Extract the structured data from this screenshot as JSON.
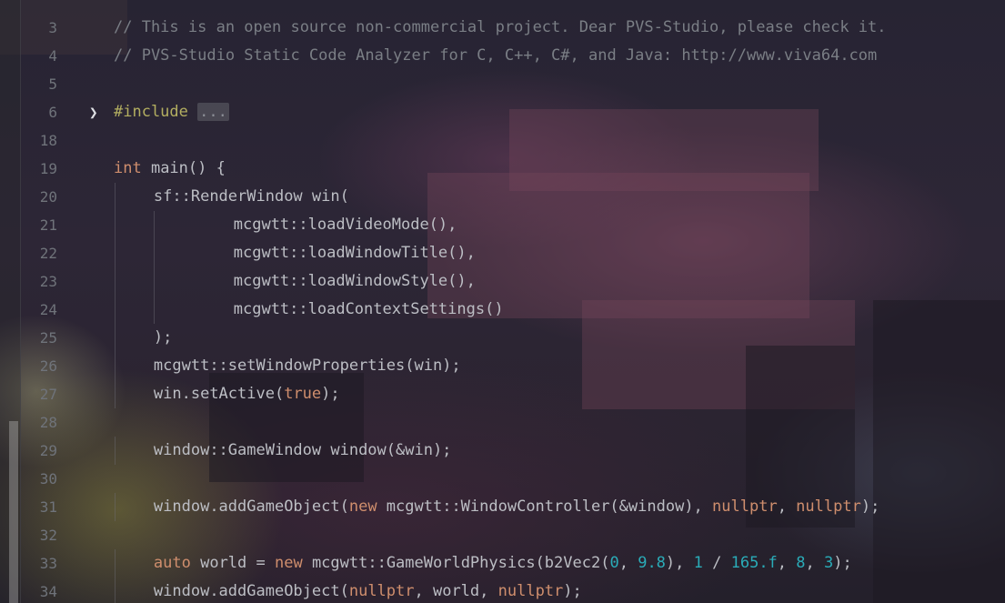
{
  "editor": {
    "lines": [
      {
        "n": "3",
        "indent": 0,
        "tokens": [
          {
            "t": "// This is an open source non-commercial project. Dear PVS-Studio, please check it.",
            "c": "comment"
          }
        ]
      },
      {
        "n": "4",
        "indent": 0,
        "tokens": [
          {
            "t": "// PVS-Studio Static Code Analyzer for C, C++, C#, and Java: http://www.viva64.com",
            "c": "comment"
          }
        ]
      },
      {
        "n": "5",
        "indent": 0,
        "tokens": []
      },
      {
        "n": "6",
        "indent": 0,
        "fold": true,
        "tokens": [
          {
            "t": "#include",
            "c": "pp"
          },
          {
            "t": " ",
            "c": "plain"
          },
          {
            "t": "...",
            "c": "fold"
          }
        ]
      },
      {
        "n": "18",
        "indent": 0,
        "tokens": []
      },
      {
        "n": "19",
        "indent": 0,
        "tokens": [
          {
            "t": "int",
            "c": "kw"
          },
          {
            "t": " main() {",
            "c": "plain"
          }
        ]
      },
      {
        "n": "20",
        "indent": 4,
        "tokens": [
          {
            "t": "sf::RenderWindow win(",
            "c": "plain"
          }
        ]
      },
      {
        "n": "21",
        "indent": 12,
        "tokens": [
          {
            "t": "mcgwtt::loadVideoMode(),",
            "c": "plain"
          }
        ]
      },
      {
        "n": "22",
        "indent": 12,
        "tokens": [
          {
            "t": "mcgwtt::loadWindowTitle(),",
            "c": "plain"
          }
        ]
      },
      {
        "n": "23",
        "indent": 12,
        "tokens": [
          {
            "t": "mcgwtt::loadWindowStyle(),",
            "c": "plain"
          }
        ]
      },
      {
        "n": "24",
        "indent": 12,
        "tokens": [
          {
            "t": "mcgwtt::loadContextSettings()",
            "c": "plain"
          }
        ]
      },
      {
        "n": "25",
        "indent": 4,
        "tokens": [
          {
            "t": ");",
            "c": "plain"
          }
        ]
      },
      {
        "n": "26",
        "indent": 4,
        "tokens": [
          {
            "t": "mcgwtt::setWindowProperties(win);",
            "c": "plain"
          }
        ]
      },
      {
        "n": "27",
        "indent": 4,
        "tokens": [
          {
            "t": "win.setActive(",
            "c": "plain"
          },
          {
            "t": "true",
            "c": "kw"
          },
          {
            "t": ");",
            "c": "plain"
          }
        ]
      },
      {
        "n": "28",
        "indent": 0,
        "tokens": []
      },
      {
        "n": "29",
        "indent": 4,
        "tokens": [
          {
            "t": "window::GameWindow window(&win);",
            "c": "plain"
          }
        ]
      },
      {
        "n": "30",
        "indent": 0,
        "tokens": []
      },
      {
        "n": "31",
        "indent": 4,
        "tokens": [
          {
            "t": "window.addGameObject(",
            "c": "plain"
          },
          {
            "t": "new",
            "c": "kw"
          },
          {
            "t": " mcgwtt::WindowController(&window), ",
            "c": "plain"
          },
          {
            "t": "nullptr",
            "c": "kw"
          },
          {
            "t": ", ",
            "c": "plain"
          },
          {
            "t": "nullptr",
            "c": "kw"
          },
          {
            "t": ");",
            "c": "plain"
          }
        ]
      },
      {
        "n": "32",
        "indent": 0,
        "tokens": []
      },
      {
        "n": "33",
        "indent": 4,
        "tokens": [
          {
            "t": "auto",
            "c": "kw"
          },
          {
            "t": " world = ",
            "c": "plain"
          },
          {
            "t": "new",
            "c": "kw"
          },
          {
            "t": " mcgwtt::GameWorldPhysics(b2Vec2(",
            "c": "plain"
          },
          {
            "t": "0",
            "c": "num"
          },
          {
            "t": ", ",
            "c": "plain"
          },
          {
            "t": "9.8",
            "c": "num"
          },
          {
            "t": "), ",
            "c": "plain"
          },
          {
            "t": "1",
            "c": "num"
          },
          {
            "t": " / ",
            "c": "plain"
          },
          {
            "t": "165.f",
            "c": "num"
          },
          {
            "t": ", ",
            "c": "plain"
          },
          {
            "t": "8",
            "c": "num"
          },
          {
            "t": ", ",
            "c": "plain"
          },
          {
            "t": "3",
            "c": "num"
          },
          {
            "t": ");",
            "c": "plain"
          }
        ]
      },
      {
        "n": "34",
        "indent": 4,
        "tokens": [
          {
            "t": "window.addGameObject(",
            "c": "plain"
          },
          {
            "t": "nullptr",
            "c": "kw"
          },
          {
            "t": ", world, ",
            "c": "plain"
          },
          {
            "t": "nullptr",
            "c": "kw"
          },
          {
            "t": ");",
            "c": "plain"
          }
        ]
      }
    ]
  },
  "colors": {
    "comment": "#7a7e85",
    "keyword": "#cf8e6d",
    "preprocessor": "#b3ae60",
    "number": "#2aacb8",
    "text": "#bcbec4",
    "line_number": "#6f737a"
  }
}
